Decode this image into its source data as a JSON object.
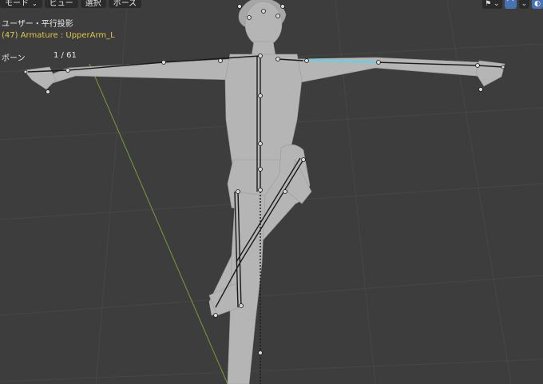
{
  "header": {
    "menus": [
      {
        "label": "モード"
      },
      {
        "label": "ビュー"
      },
      {
        "label": "選択"
      },
      {
        "label": "ポーズ"
      }
    ],
    "right_icons": [
      {
        "name": "gizmo-visibility-icon",
        "glyph": "⚑"
      },
      {
        "name": "overlay-icon",
        "glyph": "⌒"
      },
      {
        "name": "shading-icon",
        "glyph": "◐"
      }
    ]
  },
  "overlay": {
    "view_label": "ユーザー・平行投影",
    "object_info": "(47) Armature : UpperArm_L",
    "bone_label": "ボーン",
    "bone_count": "1 / 61"
  },
  "colors": {
    "background": "#3d3d3d",
    "grid": "#474747",
    "y_axis": "#7a9b3a",
    "active_bone": "#5fd3e6",
    "bone": "#1a1a1a",
    "mesh": "#b5b5b5",
    "info_text": "#e0c64a"
  }
}
